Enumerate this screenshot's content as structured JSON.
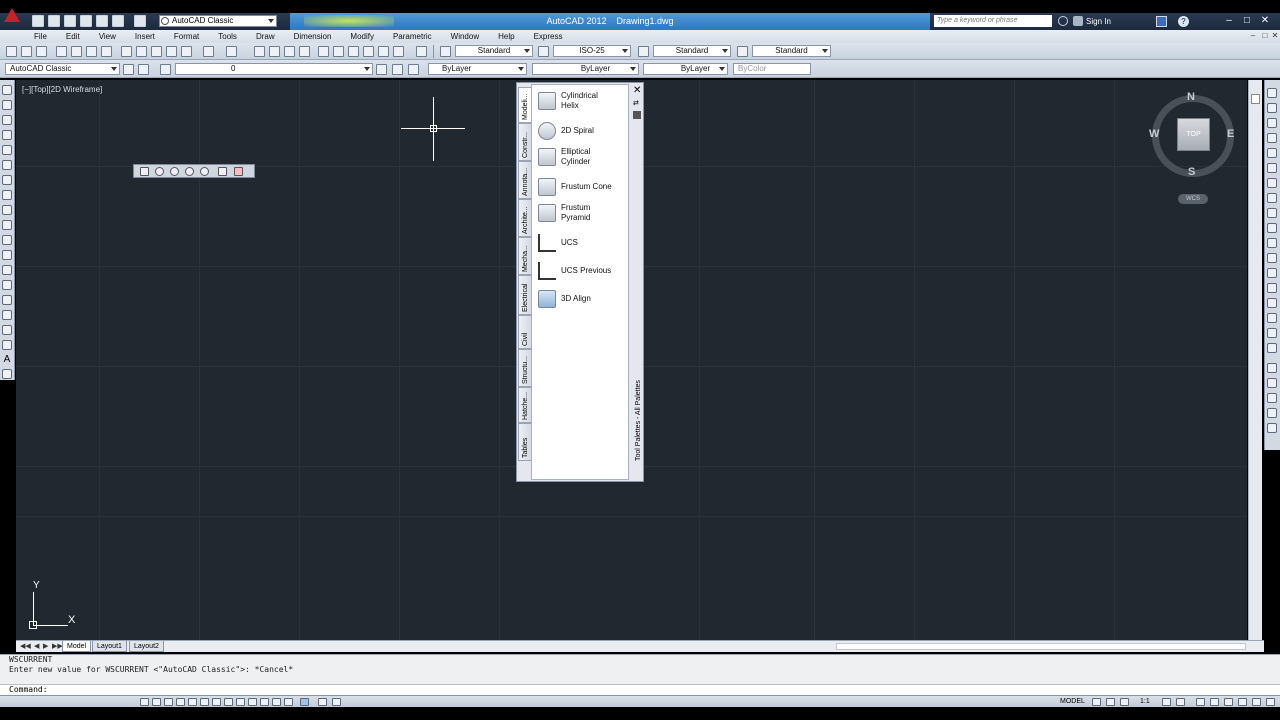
{
  "app": {
    "title": "AutoCAD 2012    Drawing1.dwg",
    "workspace": "AutoCAD Classic",
    "search_placeholder": "Type a keyword or phrase",
    "signin": "Sign In",
    "help": "?"
  },
  "menu": [
    "File",
    "Edit",
    "View",
    "Insert",
    "Format",
    "Tools",
    "Draw",
    "Dimension",
    "Modify",
    "Parametric",
    "Window",
    "Help",
    "Express"
  ],
  "toolbar": {
    "text_style": "Standard",
    "dim_style": "ISO-25",
    "table_style": "Standard",
    "mleader_style": "Standard",
    "workspace": "AutoCAD Classic",
    "layer": "0",
    "color": "ByLayer",
    "linetype": "ByLayer",
    "lineweight": "ByLayer",
    "plotstyle": "ByColor"
  },
  "viewport": {
    "label": "[−][Top][2D Wireframe]",
    "ucs_x": "X",
    "ucs_y": "Y"
  },
  "viewcube": {
    "top": "TOP",
    "n": "N",
    "s": "S",
    "e": "E",
    "w": "W",
    "wcs": "WCS"
  },
  "palette": {
    "title": "Tool Palettes - All Palettes",
    "tabs": [
      "Modeli...",
      "Constr...",
      "Annota...",
      "Archite...",
      "Mecha...",
      "Electrical",
      "Civil",
      "Structu...",
      "Hatche...",
      "Tables"
    ],
    "items": [
      {
        "label_1": "Cylindrical",
        "label_2": "Helix",
        "icon": "helix-icon"
      },
      {
        "label_1": "2D Spiral",
        "label_2": "",
        "icon": "spiral-icon"
      },
      {
        "label_1": "Elliptical",
        "label_2": "Cylinder",
        "icon": "cylinder-icon"
      },
      {
        "label_1": "Frustum Cone",
        "label_2": "",
        "icon": "cone-icon"
      },
      {
        "label_1": "Frustum",
        "label_2": "Pyramid",
        "icon": "pyramid-icon"
      },
      {
        "label_1": "UCS",
        "label_2": "",
        "icon": "ucs-icon"
      },
      {
        "label_1": "UCS Previous",
        "label_2": "",
        "icon": "ucs-previous-icon"
      },
      {
        "label_1": "3D Align",
        "label_2": "",
        "icon": "align-icon"
      }
    ]
  },
  "layouts": [
    "Model",
    "Layout1",
    "Layout2"
  ],
  "command": {
    "history_1": "WSCURRENT",
    "history_2": "Enter new value for WSCURRENT <\"AutoCAD Classic\">: *Cancel*",
    "prompt": "Command:"
  },
  "status": {
    "model": "MODEL",
    "scale": "1:1"
  }
}
